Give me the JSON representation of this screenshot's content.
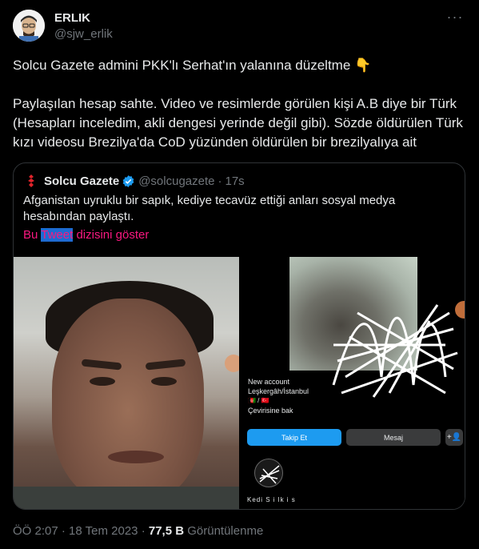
{
  "author": {
    "name": "ERLIK",
    "handle": "@sjw_erlik",
    "avatar_icon": "cartoon-avatar-icon"
  },
  "more_icon": "more-dots-icon",
  "tweet": {
    "line1": "Solcu Gazete admini PKK'lı Serhat'ın yalanına düzeltme 👇",
    "paragraph2": "Paylaşılan hesap sahte. Video ve resimlerde görülen kişi A.B diye bir Türk (Hesapları inceledim, akli dengesi yerinde değil gibi). Sözde öldürülen Türk kızı videosu Brezilya'da CoD yüzünden öldürülen bir brezilyalıya ait"
  },
  "quote": {
    "avatar_icon": "red-logo-icon",
    "name": "Solcu Gazete",
    "verified_icon": "verified-badge-icon",
    "handle": "@solcugazete",
    "dot": "·",
    "time": "17s",
    "text": "Afganistan uyruklu bir sapık, kediye tecavüz ettiği anları sosyal medya hesabından paylaştı.",
    "show_thread_pre": "Bu ",
    "show_thread_sel": "Tweet",
    "show_thread_post": " dizisini göster",
    "profile": {
      "line1": "New account",
      "line2": "Leşkergâh/İstanbul",
      "flags": "🇦🇫 / 🇹🇷",
      "line4": "Çevirisine bak",
      "follow": "Takip Et",
      "message": "Mesaj",
      "add_icon": "+👤",
      "story": "Kedi S i lk i s"
    }
  },
  "meta": {
    "time": "ÖÖ 2:07",
    "sep1": "·",
    "date": "18 Tem 2023",
    "sep2": "·",
    "views": "77,5 B",
    "views_label": "Görüntülenme"
  },
  "colors": {
    "background": "#000000",
    "text": "#e7e9ea",
    "muted": "#71767b",
    "link_pink": "#f91880",
    "verified_blue": "#1d9bf0"
  }
}
